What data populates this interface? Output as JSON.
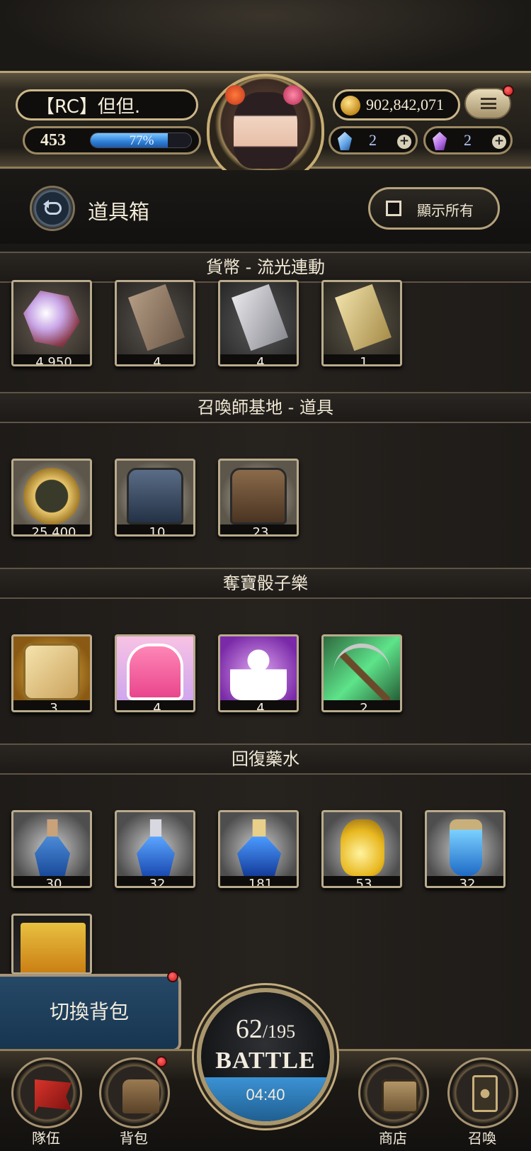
{
  "player": {
    "name": "【RC】但但.",
    "level": "453",
    "xp_percent_text": "77%",
    "xp_fraction": 0.77,
    "gold": "902,842,071",
    "gem_blue": "2",
    "gem_purple": "2"
  },
  "header": {
    "title": "道具箱",
    "show_all_label": "顯示所有"
  },
  "sections": [
    {
      "title": "貨幣 - 流光連動",
      "items": [
        {
          "icon": "crystal-icon",
          "count": "4,950"
        },
        {
          "icon": "bronze-card-icon",
          "count": "4"
        },
        {
          "icon": "silver-card-icon",
          "count": "4"
        },
        {
          "icon": "gold-card-icon",
          "count": "1"
        }
      ]
    },
    {
      "title": "召喚師基地 - 道具",
      "items": [
        {
          "icon": "gold-coin-icon",
          "count": "25,400"
        },
        {
          "icon": "blue-bag-icon",
          "count": "10"
        },
        {
          "icon": "brown-bag-icon",
          "count": "23"
        }
      ]
    },
    {
      "title": "奪寶骰子樂",
      "items": [
        {
          "icon": "dice-icon",
          "count": "3"
        },
        {
          "icon": "kawaii-icon",
          "count": "4"
        },
        {
          "icon": "muscle-icon",
          "count": "4"
        },
        {
          "icon": "pickaxe-icon",
          "count": "2"
        }
      ]
    },
    {
      "title": "回復藥水",
      "items": [
        {
          "icon": "potion-small-icon",
          "count": "30"
        },
        {
          "icon": "potion-medium-icon",
          "count": "32"
        },
        {
          "icon": "potion-large-icon",
          "count": "181"
        },
        {
          "icon": "potion-gold-icon",
          "count": "53"
        },
        {
          "icon": "potion-bottle-icon",
          "count": "32"
        },
        {
          "icon": "snack-bag-icon",
          "count": ""
        }
      ]
    }
  ],
  "bottom": {
    "switch_bag_label": "切換背包",
    "nav": [
      {
        "label": "隊伍",
        "icon": "flag-icon"
      },
      {
        "label": "背包",
        "icon": "bag-icon"
      },
      {
        "label": "商店",
        "icon": "shop-icon"
      },
      {
        "label": "召喚",
        "icon": "summon-card-icon"
      }
    ],
    "battle": {
      "stamina_current": "62",
      "stamina_max": "/195",
      "label": "BATTLE",
      "timer": "04:40"
    }
  },
  "colors": {
    "gold_trim": "#cbb68a",
    "xp_bar": "#2d7fd6",
    "notification": "#d11414",
    "switch_bag_bg": "#264967"
  }
}
